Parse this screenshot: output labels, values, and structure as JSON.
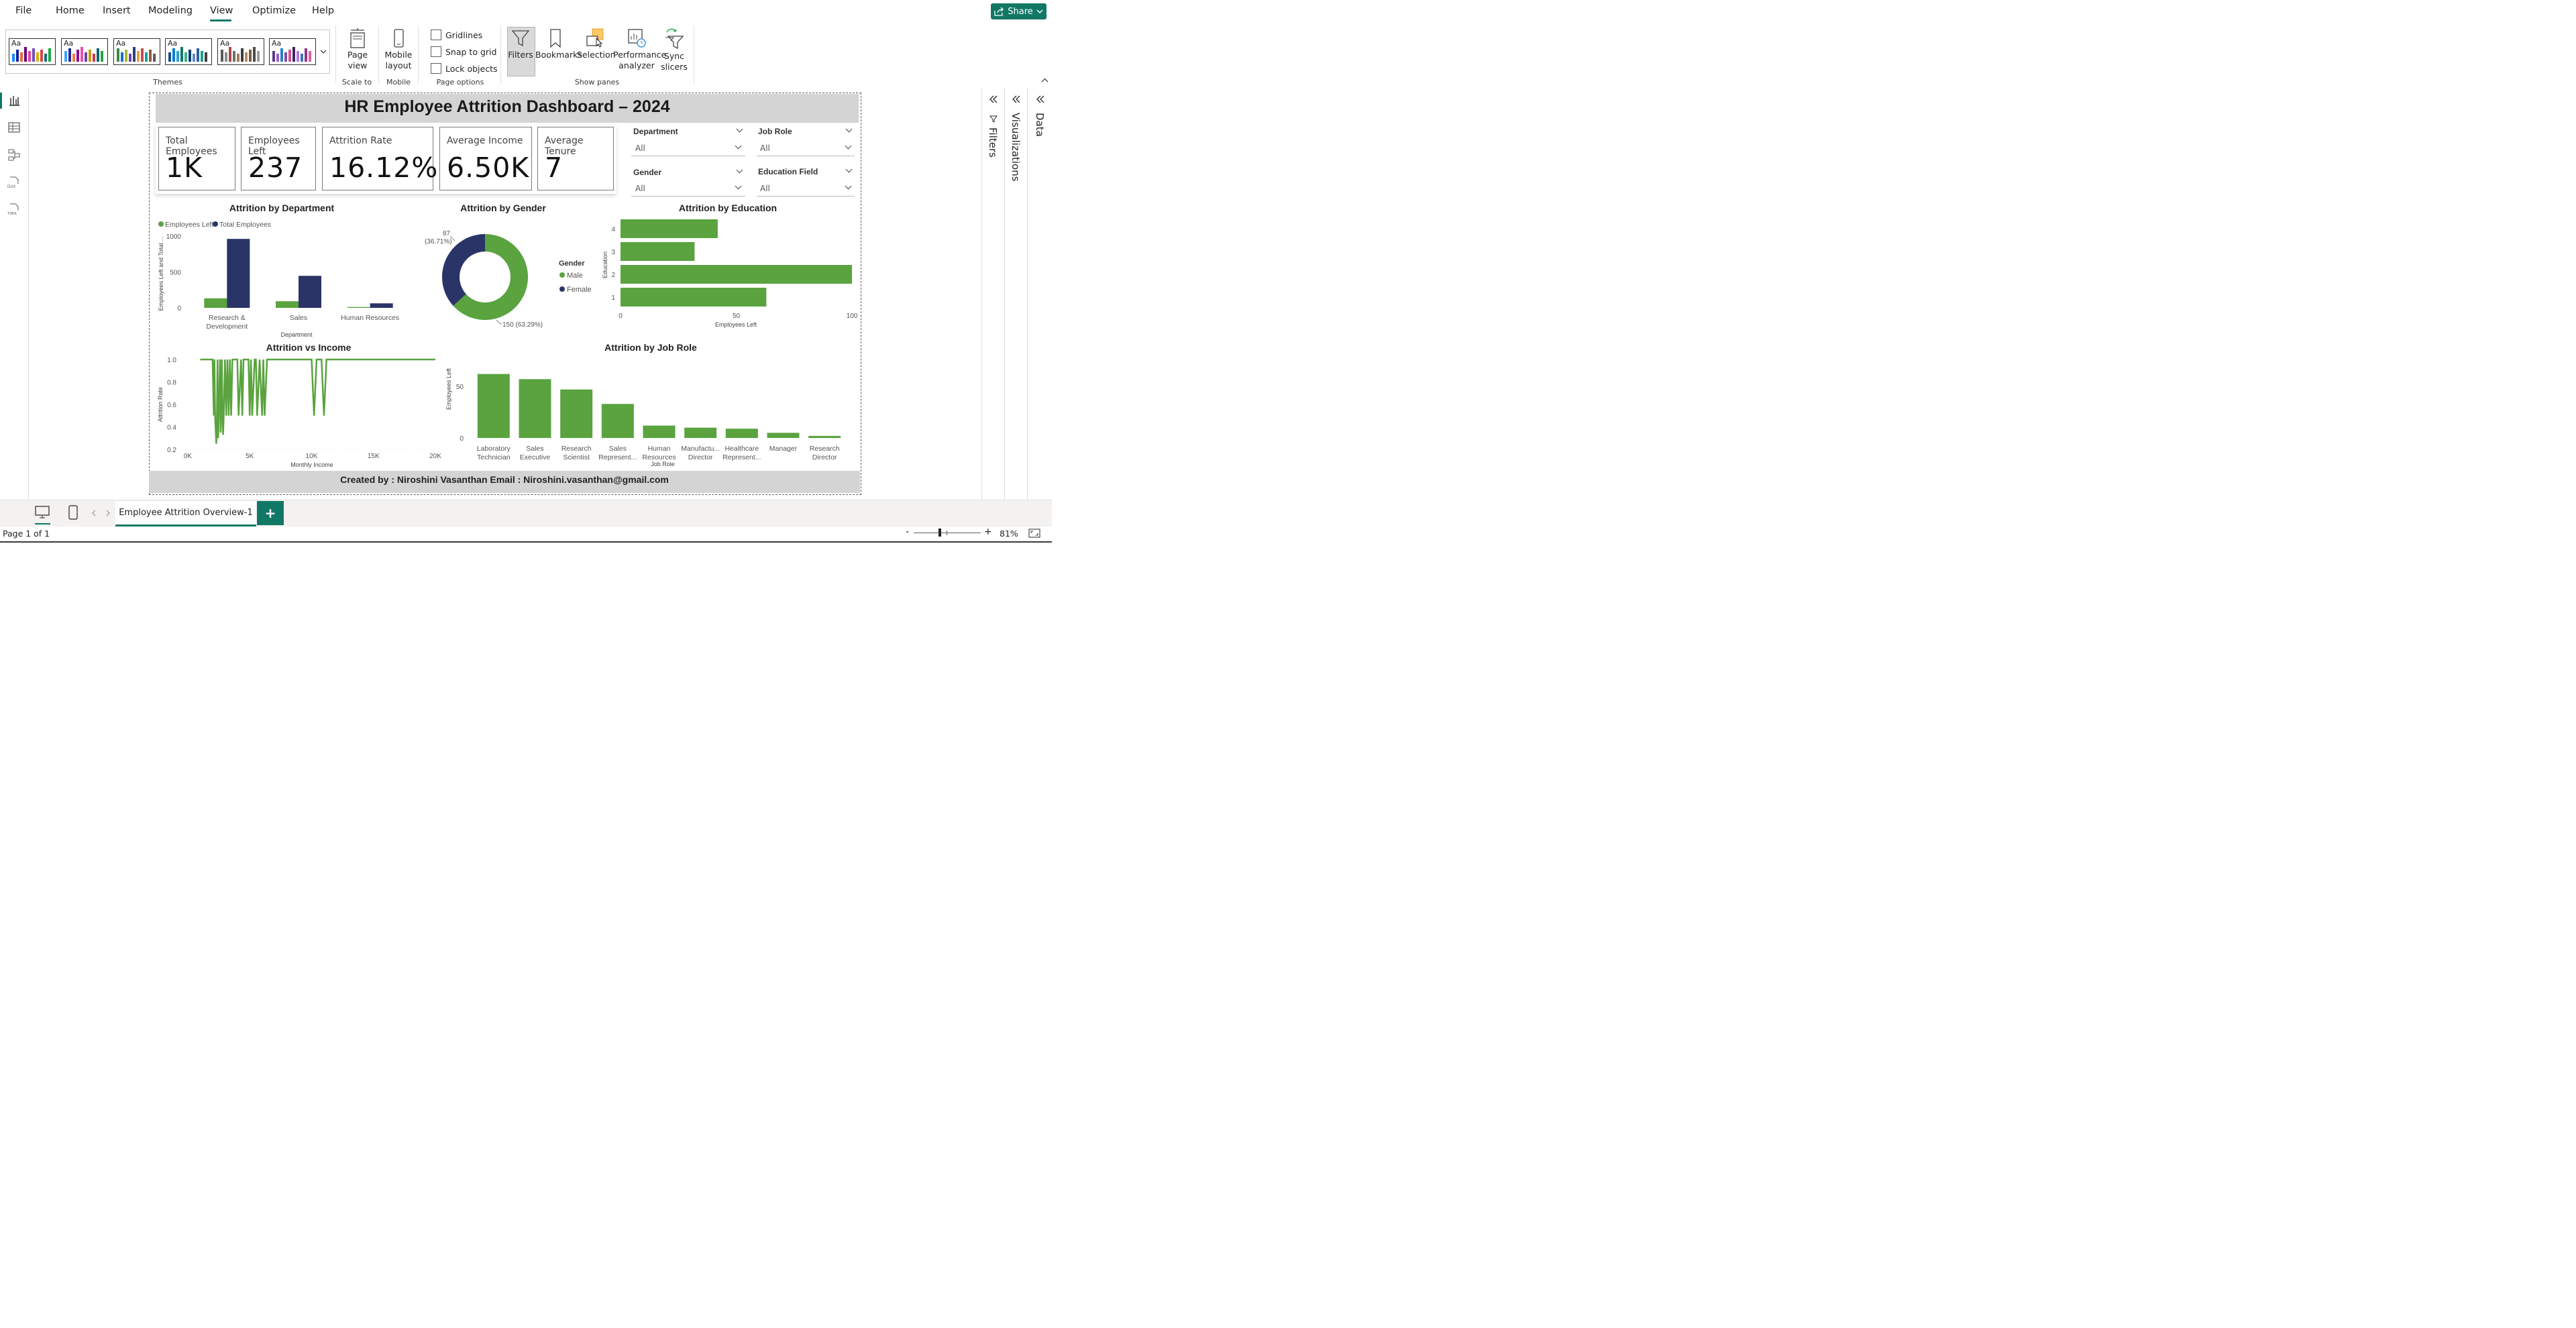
{
  "menu": {
    "items": [
      "File",
      "Home",
      "Insert",
      "Modeling",
      "View",
      "Optimize",
      "Help"
    ],
    "active": "View",
    "share": "Share"
  },
  "ribbon": {
    "groups": {
      "themes": "Themes",
      "scale": "Scale to fit",
      "mobile": "Mobile",
      "page_options": "Page options",
      "show_panes": "Show panes"
    },
    "page_view": "Page view",
    "mobile_layout": "Mobile layout",
    "checkboxes": [
      "Gridlines",
      "Snap to grid",
      "Lock objects"
    ],
    "panes": [
      "Filters",
      "Bookmarks",
      "Selection",
      "Performance analyzer",
      "Sync slicers"
    ]
  },
  "report": {
    "title": "HR Employee Attrition Dashboard – 2024",
    "kpis": [
      {
        "label": "Total Employees",
        "value": "1K"
      },
      {
        "label": "Employees Left",
        "value": "237"
      },
      {
        "label": "Attrition Rate",
        "value": "16.12%"
      },
      {
        "label": "Average Income",
        "value": "6.50K"
      },
      {
        "label": "Average Tenure",
        "value": "7"
      }
    ],
    "slicers": [
      {
        "title": "Department",
        "value": "All"
      },
      {
        "title": "Job Role",
        "value": "All"
      },
      {
        "title": "Gender",
        "value": "All"
      },
      {
        "title": "Education Field",
        "value": "All"
      }
    ],
    "footer": "Created by : Niroshini Vasanthan Email : Niroshini.vasanthan@gmail.com"
  },
  "colors": {
    "green": "#5aa33f",
    "navy": "#2b3467",
    "accent": "#117865"
  },
  "chart_data": [
    {
      "type": "bar",
      "title": "Attrition by Department",
      "categories": [
        "Research & Development",
        "Sales",
        "Human Resources"
      ],
      "series": [
        {
          "name": "Employees Left",
          "values": [
            133,
            92,
            12
          ]
        },
        {
          "name": "Total Employees",
          "values": [
            961,
            446,
            63
          ]
        }
      ],
      "xlabel": "Department",
      "ylabel": "Employees Left and Total ...",
      "yticks": [
        "0",
        "500",
        "1000"
      ],
      "ylim": [
        0,
        1000
      ],
      "legend": "top-left"
    },
    {
      "type": "pie",
      "title": "Attrition by Gender",
      "legend_title": "Gender",
      "slices": [
        {
          "name": "Male",
          "value": 150,
          "label": "150 (63.29%)"
        },
        {
          "name": "Female",
          "value": 87,
          "label_value": "87",
          "label_pct": "(36.71%)"
        }
      ]
    },
    {
      "type": "bar",
      "title": "Attrition by Education",
      "orientation": "horizontal",
      "categories": [
        "4",
        "3",
        "2",
        "1"
      ],
      "values": [
        42,
        32,
        100,
        63
      ],
      "xlabel": "Employees Left",
      "ylabel": "Education",
      "xticks": [
        "0",
        "50",
        "100"
      ],
      "xlim": [
        0,
        100
      ]
    },
    {
      "type": "line",
      "title": "Attrition vs Income",
      "xlabel": "Monthly Income",
      "ylabel": "Attrition Rate",
      "xticks": [
        "0K",
        "5K",
        "10K",
        "15K",
        "20K"
      ],
      "yticks": [
        "0.2",
        "0.4",
        "0.6",
        "0.8",
        "1.0"
      ],
      "xlim": [
        0,
        20000
      ],
      "ylim": [
        0.2,
        1.0
      ],
      "x": [
        1000,
        2000,
        2100,
        2150,
        2200,
        2300,
        2350,
        2400,
        2450,
        2500,
        2600,
        2650,
        2700,
        2750,
        2800,
        2850,
        2900,
        3000,
        3100,
        3200,
        3300,
        3400,
        3500,
        3600,
        3700,
        4000,
        4100,
        4300,
        4400,
        4500,
        4600,
        4700,
        4900,
        5000,
        5100,
        5200,
        5400,
        5500,
        5600,
        5800,
        6000,
        6100,
        6200,
        6400,
        6500,
        7000,
        10000,
        10200,
        10400,
        10600,
        10800,
        11000,
        11200,
        11400,
        20000
      ],
      "y": [
        1.0,
        1.0,
        0.5,
        1.0,
        0.5,
        0.25,
        0.5,
        1.0,
        0.3,
        0.5,
        1.0,
        0.35,
        0.5,
        1.0,
        0.5,
        0.33,
        0.5,
        1.0,
        0.5,
        1.0,
        0.5,
        1.0,
        0.5,
        1.0,
        1.0,
        1.0,
        0.5,
        1.0,
        0.5,
        1.0,
        1.0,
        1.0,
        1.0,
        0.5,
        1.0,
        0.5,
        1.0,
        1.0,
        0.5,
        1.0,
        0.5,
        1.0,
        0.5,
        1.0,
        1.0,
        1.0,
        1.0,
        0.5,
        1.0,
        1.0,
        1.0,
        0.5,
        1.0,
        1.0,
        1.0
      ]
    },
    {
      "type": "bar",
      "title": "Attrition by Job Role",
      "categories": [
        "Laboratory Technician",
        "Sales Executive",
        "Research Scientist",
        "Sales Represent...",
        "Human Resources",
        "Manufactu... Director",
        "Healthcare Represent...",
        "Manager",
        "Research Director"
      ],
      "category_lines": [
        [
          "Laboratory",
          "Technician"
        ],
        [
          "Sales",
          "Executive"
        ],
        [
          "Research",
          "Scientist"
        ],
        [
          "Sales",
          "Represent..."
        ],
        [
          "Human",
          "Resources"
        ],
        [
          "Manufactu...",
          "Director"
        ],
        [
          "Healthcare",
          "Represent..."
        ],
        [
          "Manager"
        ],
        [
          "Research",
          "Director"
        ]
      ],
      "values": [
        62,
        57,
        47,
        33,
        12,
        10,
        9,
        5,
        2
      ],
      "xlabel": "Job Role",
      "ylabel": "Employees Left",
      "yticks": [
        "0",
        "50"
      ],
      "ylim": [
        0,
        65
      ]
    }
  ],
  "panes": {
    "filters": "Filters",
    "visualizations": "Visualizations",
    "data": "Data"
  },
  "tabs": {
    "page": "Employee Attrition Overview-1",
    "add": "+"
  },
  "status": {
    "page": "Page 1 of 1",
    "zoom": "81%"
  }
}
